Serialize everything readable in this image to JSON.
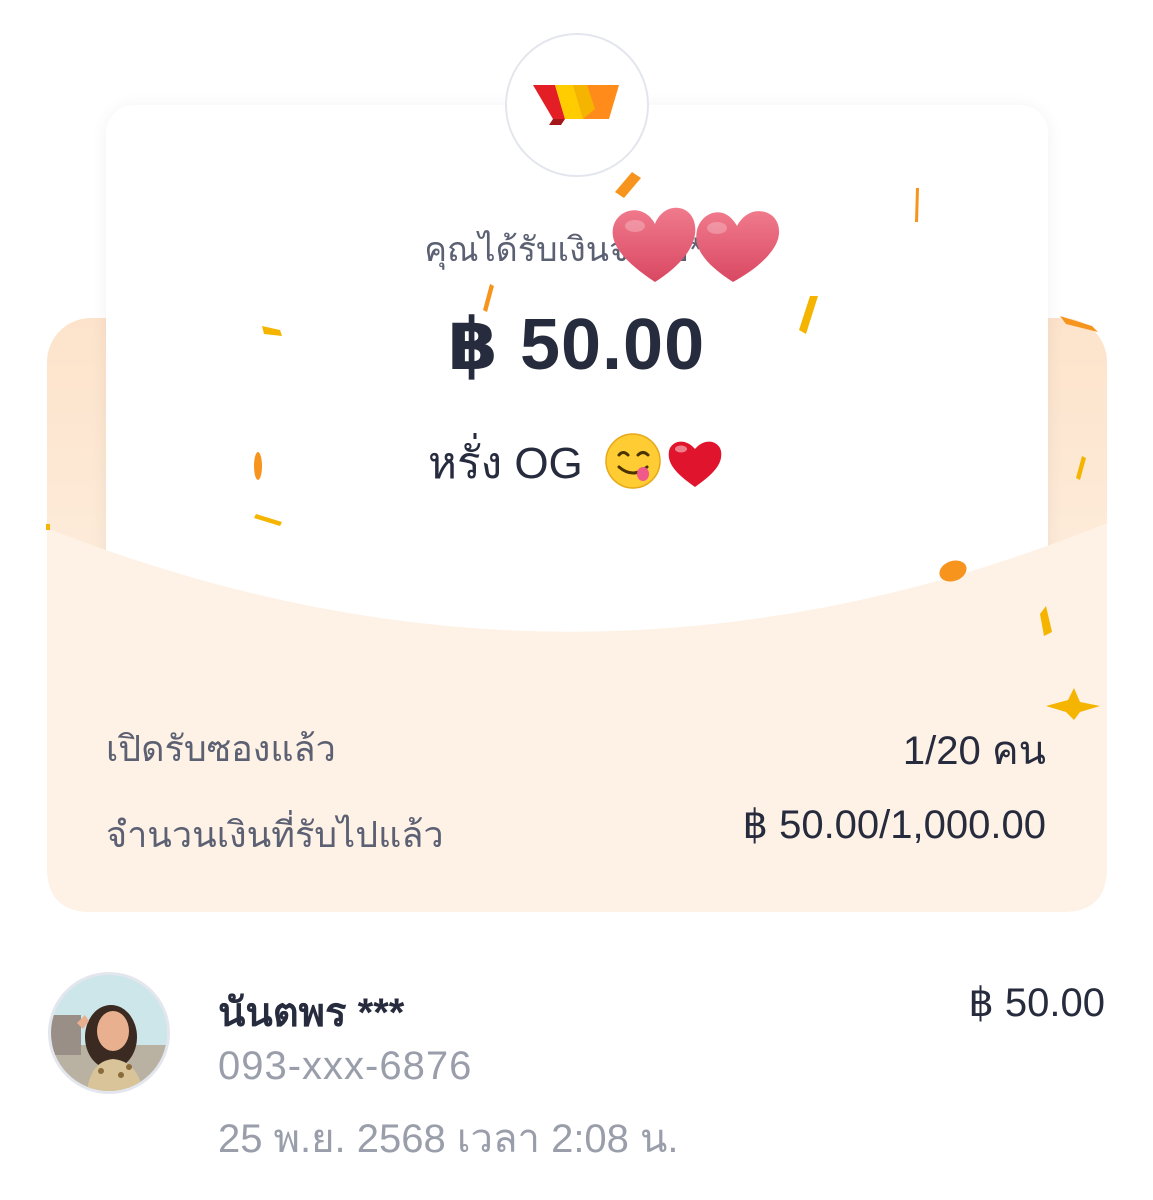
{
  "app": {
    "logo_icon": "truemoney-wallet-logo-icon"
  },
  "envelope": {
    "received_from_text": "คุณได้รับเงินจากอ***",
    "amount": "฿ 50.00",
    "message_text": "หรั่ง OG",
    "message_emojis": "😋❤️",
    "sender_name_redaction": "heart-stickers"
  },
  "stats": {
    "opened_label": "เปิดรับซองแล้ว",
    "opened_value": "1/20 คน",
    "opened_count": 1,
    "opened_total": 20,
    "claimed_label": "จำนวนเงินที่รับไปแล้ว",
    "claimed_value": "฿ 50.00/1,000.00",
    "claimed_amount": 50,
    "total_amount": 1000
  },
  "recipients": [
    {
      "name": "นันตพร ***",
      "phone": "093-xxx-6876",
      "time": "25 พ.ย. 2568 เวลา 2:08 น.",
      "amount": "฿ 50.00"
    }
  ],
  "colors": {
    "envelope_peach": "#fde3cb",
    "text_dark": "#262b3d",
    "text_muted": "#9a9eab",
    "confetti_orange": "#f7941d",
    "heart_pink": "#e85a70"
  }
}
